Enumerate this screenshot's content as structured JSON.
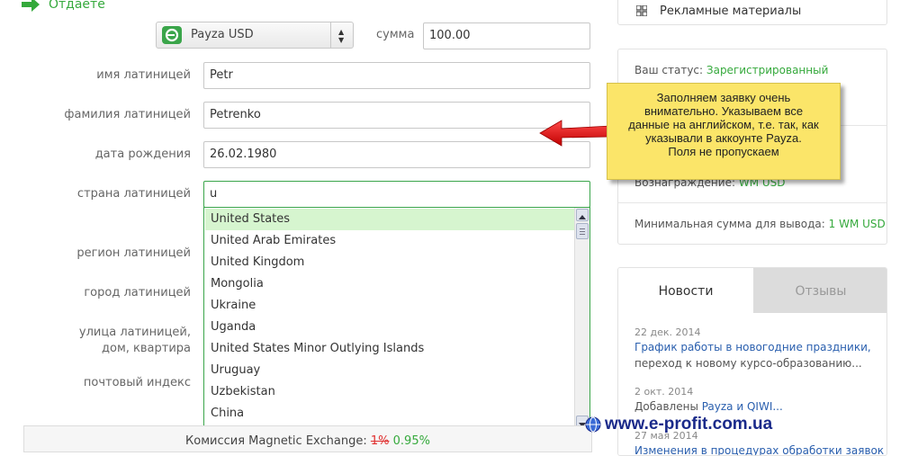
{
  "left_form": {
    "otdaete_label": "Отдаете",
    "payment_system": "Payza USD",
    "summa_label": "сумма",
    "summa_value": "100.00",
    "fields": [
      {
        "label": "имя латиницей",
        "value": "Petr"
      },
      {
        "label": "фамилия латиницей",
        "value": "Petrenko"
      },
      {
        "label": "дата рождения",
        "value": "26.02.1980"
      },
      {
        "label": "страна латиницей",
        "value": "u"
      }
    ],
    "hidden_labels": {
      "region": "регион латиницей",
      "city": "город латиницей",
      "street_line1": "улица латиницей,",
      "street_line2": "дом, квартира",
      "postal": "почтовый индекс"
    }
  },
  "dropdown": {
    "items": [
      "United States",
      "United Arab Emirates",
      "United Kingdom",
      "Mongolia",
      "Ukraine",
      "Uganda",
      "United States Minor Outlying Islands",
      "Uruguay",
      "Uzbekistan",
      "China"
    ]
  },
  "commission": {
    "label": "Комиссия Magnetic Exchange:",
    "old": "1%",
    "new": "0.95%"
  },
  "right": {
    "promo": "Рекламные материалы",
    "status_label": "Ваш статус:",
    "status_value": "Зарегистрированный",
    "reward_label": "Вознаграждение:",
    "reward_value": "WM USD",
    "min_label": "Минимальная сумма для вывода:",
    "min_value": "1 WM USD",
    "tab_news": "Новости",
    "tab_reviews": "Отзывы",
    "news": [
      {
        "date": "22 дек. 2014",
        "link": "График работы в новогодние праздники,",
        "sub": "переход к новому курсо-образованию..."
      },
      {
        "date": "2 окт. 2014",
        "prefix": "Добавлены ",
        "link": "Payza и QIWI..."
      },
      {
        "date": "27 мая 2014",
        "link": "Изменения в процедурах обработки заявок"
      }
    ]
  },
  "note": {
    "lines": [
      "Заполняем заявку очень",
      "внимательно. Указываем все",
      "данные на английском, т.е. так, как",
      "указывали в аккоунте Payza.",
      "Поля не пропускаем"
    ]
  },
  "watermark": "www.e-profit.com.ua",
  "colors": {
    "green": "#35a93c",
    "link": "#2a5fae",
    "note_bg": "#fbe569",
    "arrow": "#e01818"
  }
}
